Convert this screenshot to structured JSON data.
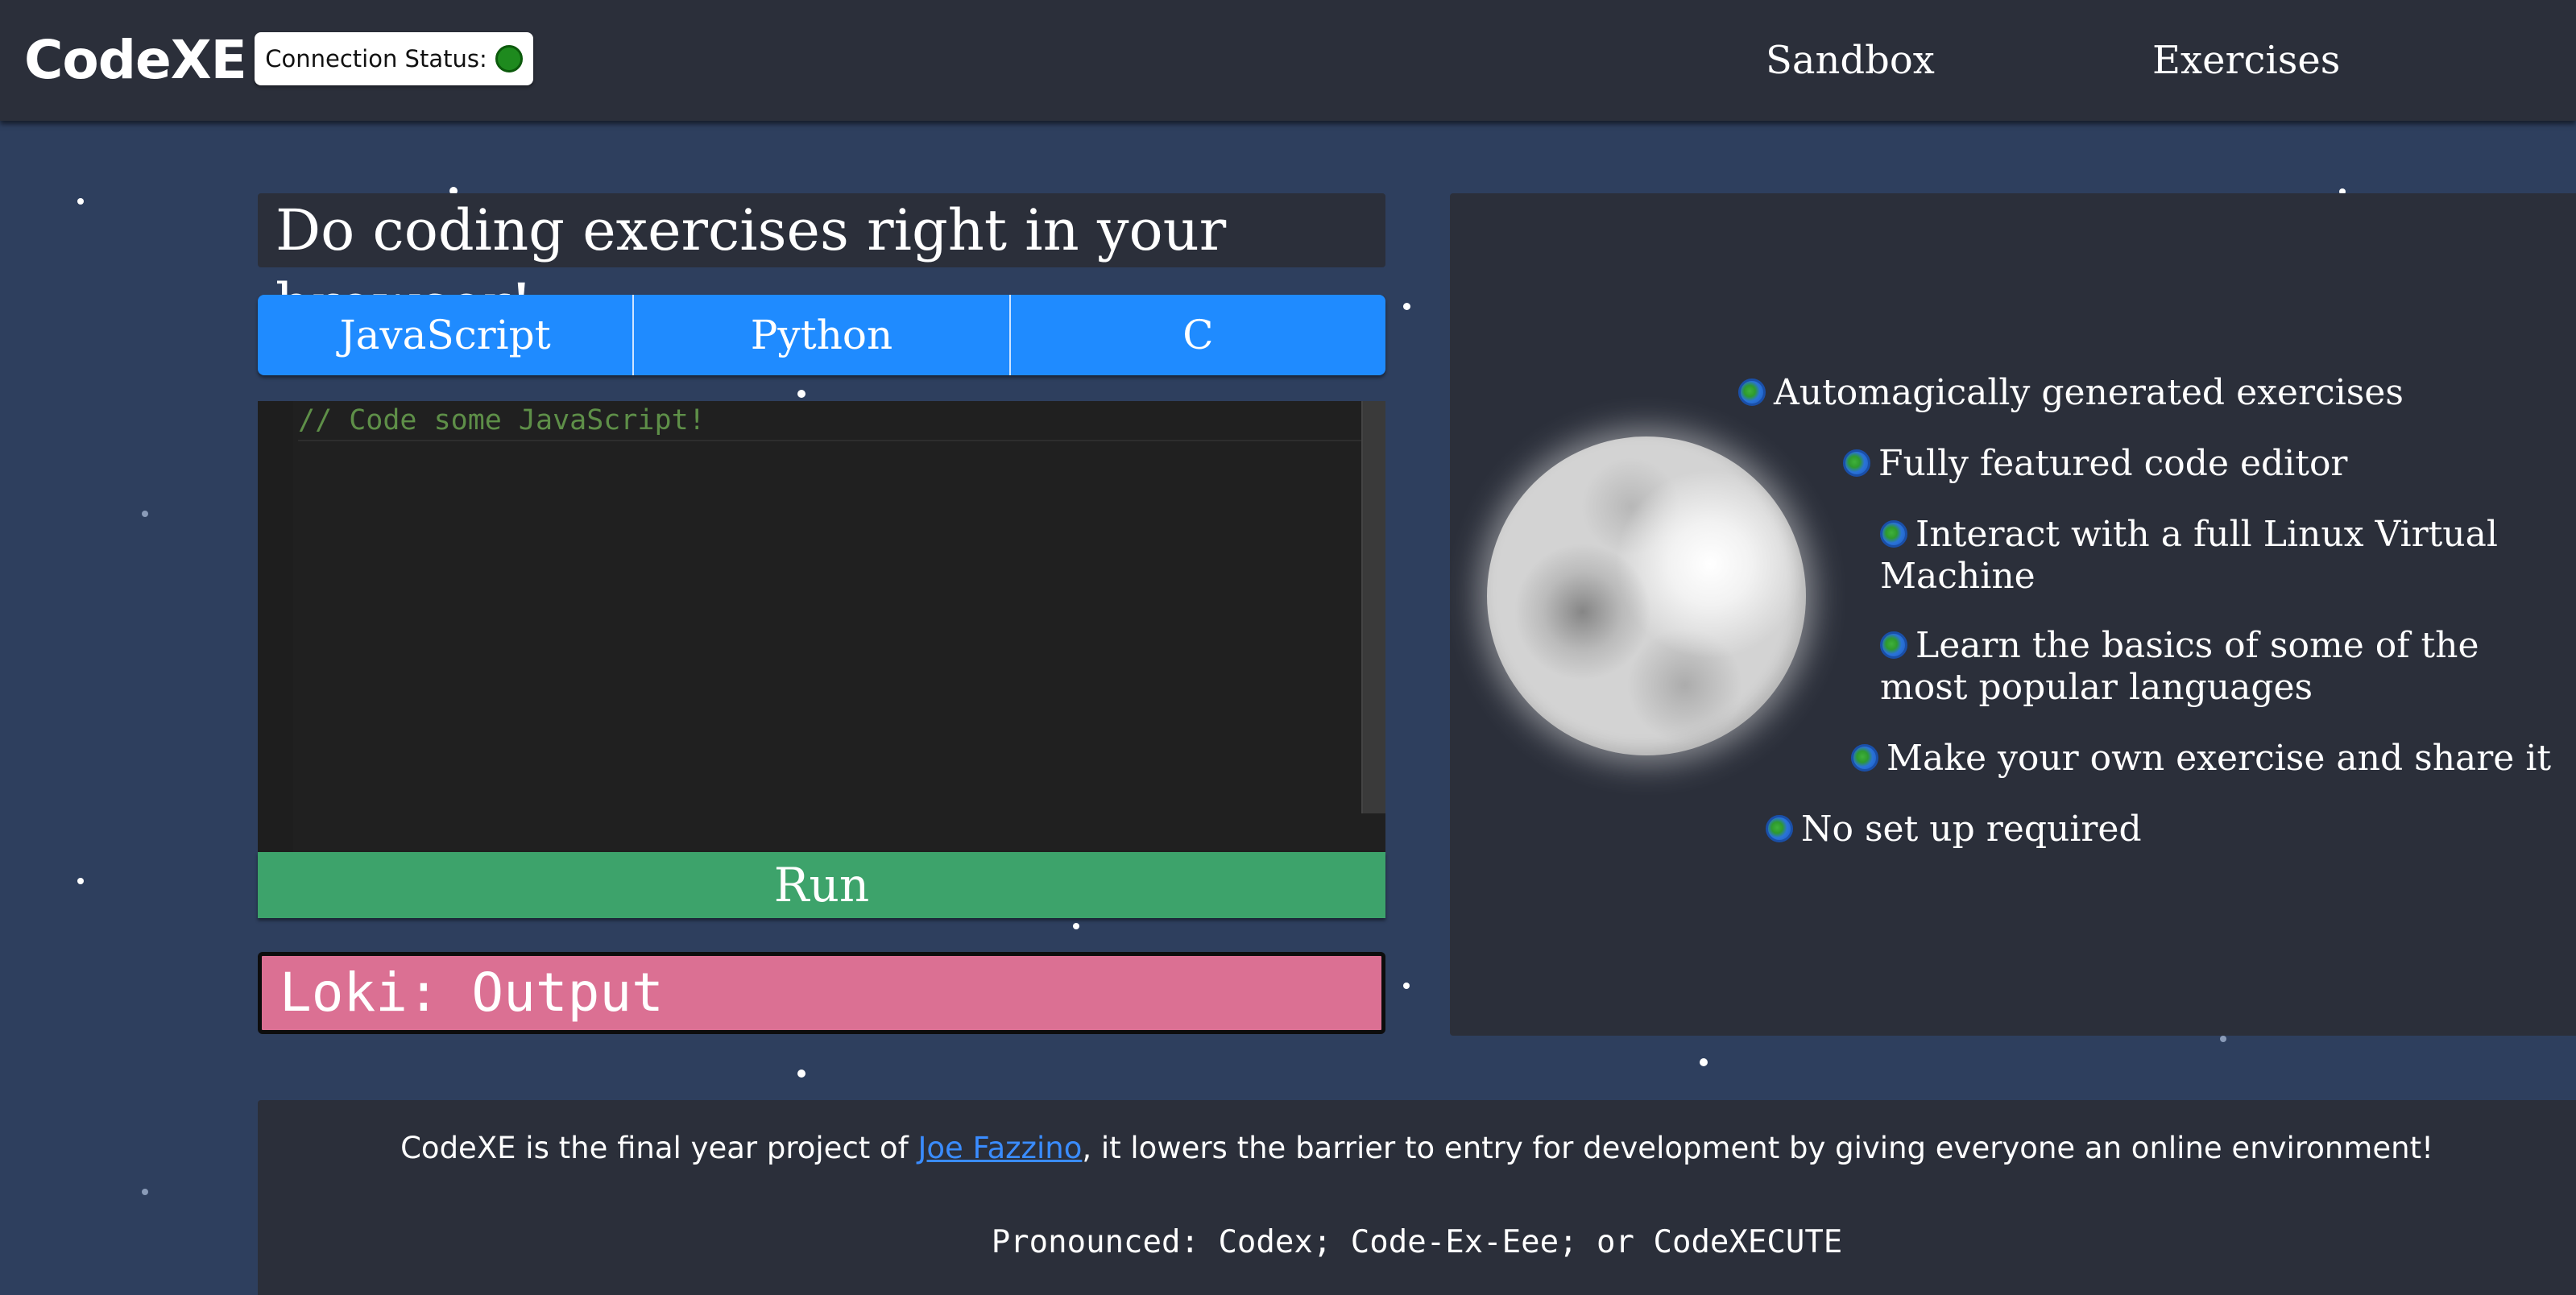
{
  "header": {
    "logo": "CodeXE",
    "connection_label": "Connection Status:",
    "connection_color": "#1e8a1e",
    "nav": [
      "Sandbox",
      "Exercises"
    ]
  },
  "main": {
    "title": "Do coding exercises right in your browser!",
    "tabs": [
      "JavaScript",
      "Python",
      "C"
    ],
    "editor_code": "// Code some JavaScript!",
    "run_label": "Run",
    "output_label": "Loki: Output"
  },
  "features": {
    "icon": "globe-icon",
    "items": [
      "Automagically generated exercises",
      "Fully featured code editor",
      "Interact with a full Linux Virtual Machine",
      "Learn the basics of some of the most popular languages",
      "Make your own exercise and share it",
      "No set up required"
    ]
  },
  "footer": {
    "text_before": "CodeXE is the final year project of ",
    "author_link": "Joe Fazzino",
    "text_after": ", it lowers the barrier to entry for development by giving everyone an online environment!",
    "pronounced": "Pronounced: Codex; Code-Ex-Eee; or CodeXECUTE"
  },
  "colors": {
    "background": "#2e3f5e",
    "panel": "#2b2f3a",
    "tab_blue": "#1f8bff",
    "run_green": "#3da36b",
    "output_pink": "#db7093",
    "link_blue": "#3a8cff"
  }
}
